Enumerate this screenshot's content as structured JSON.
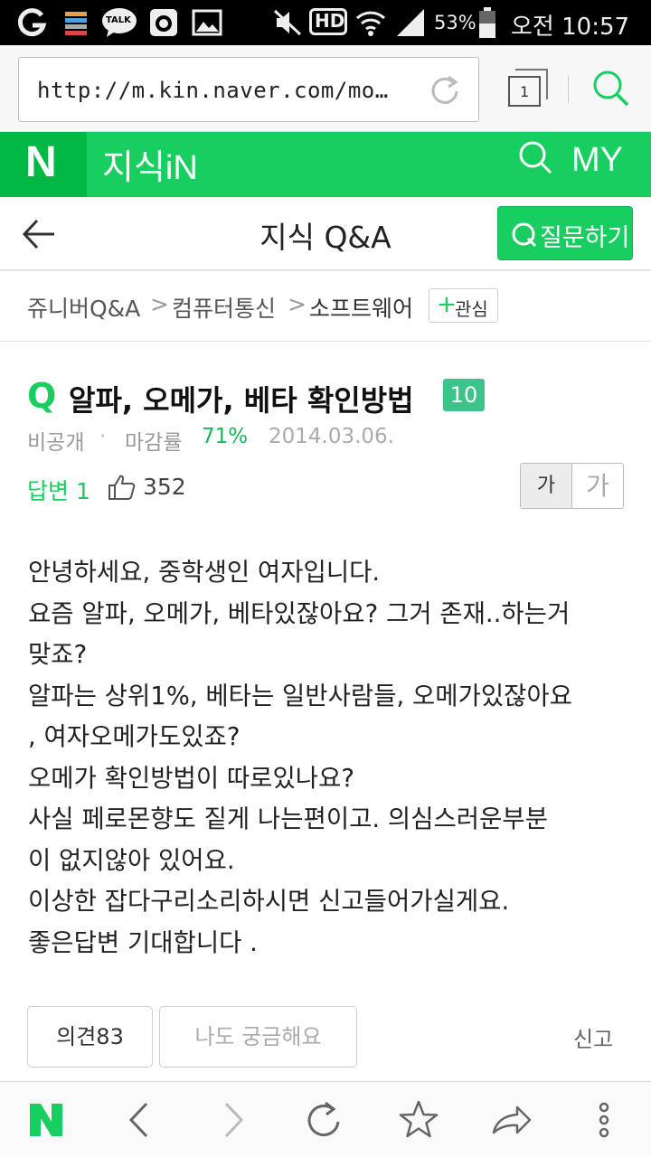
{
  "status_bar": {
    "icons": [
      "g-icon",
      "stack-icon",
      "talk-icon",
      "camera-icon",
      "image-icon",
      "mute-icon",
      "hd-icon",
      "wifi-icon",
      "signal-icon",
      "battery-icon"
    ],
    "talk_label": "TALK",
    "hd_label": "HD",
    "battery": "53%",
    "time": "오전 10:57"
  },
  "browser": {
    "url": "http://m.kin.naver.com/mo…",
    "tab_count": "1"
  },
  "header": {
    "logo": "N",
    "title": "지식iN",
    "my_label": "MY"
  },
  "subheader": {
    "title": "지식 Q&A",
    "ask_button": "질문하기"
  },
  "breadcrumb": {
    "items": [
      "쥬니버Q&A",
      "컴퓨터통신",
      "소프트웨어"
    ],
    "separator": ">",
    "interest_label": "관심"
  },
  "question": {
    "mark": "Q",
    "title": "알파, 오메가, 베타 확인방법",
    "badge": "10",
    "author": "비공개",
    "dot": "·",
    "close_rate_label": "마감률",
    "close_rate": "71%",
    "date": "2014.03.06.",
    "answers_label": "답변 1",
    "likes": "352",
    "font_small": "가",
    "font_large": "가",
    "body_lines": [
      " 안녕하세요, 중학생인 여자입니다.",
      "요즘 알파, 오메가, 베타있잖아요? 그거 존재..하는거",
      "맞죠?",
      "알파는 상위1%, 베타는 일반사람들, 오메가있잖아요",
      ", 여자오메가도있죠?",
      "오메가 확인방법이 따로있나요?",
      "사실 페로몬향도 짙게 나는편이고. 의심스러운부분",
      "이 없지않아 있어요.",
      "이상한 잡다구리소리하시면 신고들어가실게요.",
      "좋은답변 기대합니다 ."
    ]
  },
  "actions": {
    "opinion": "의견83",
    "curious": "나도 궁금해요",
    "report": "신고"
  },
  "bottom_bar": {
    "icons": [
      "naver-home-icon",
      "back-icon",
      "forward-icon",
      "refresh-icon",
      "bookmark-star-icon",
      "share-icon",
      "more-icon"
    ]
  },
  "colors": {
    "brand_green": "#19ce60",
    "dark_green": "#00b843",
    "badge_green": "#3dc48a"
  }
}
